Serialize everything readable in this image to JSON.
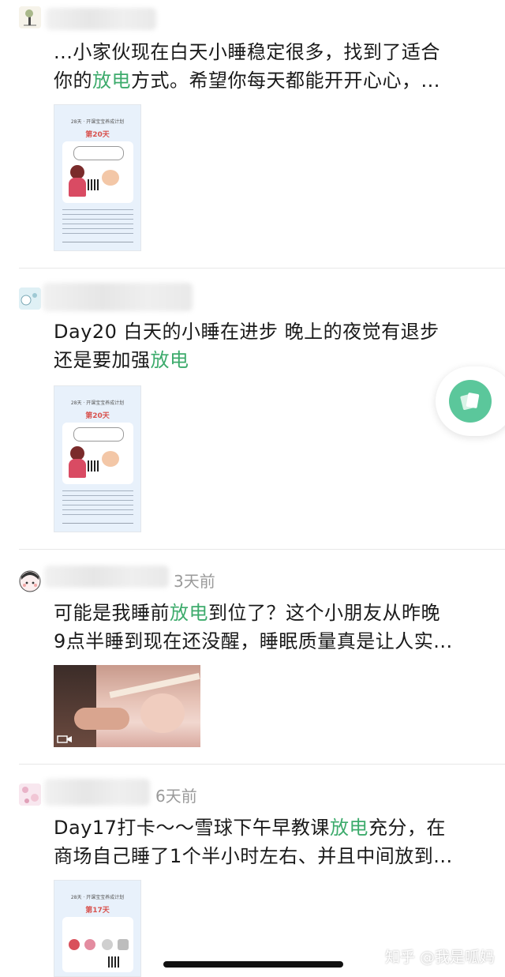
{
  "posts": [
    {
      "time": "",
      "line1_a": "...小家伙现在白天小睡稳定很多，找到了适合",
      "line1_hl": "",
      "line1_b": "",
      "line2_a": "你的",
      "line2_hl": "放电",
      "line2_b": "方式。希望你每天都能开开心心，..."
    },
    {
      "time": "",
      "line1_a": "Day20 白天的小睡在进步 晚上的夜觉有退步",
      "line1_hl": "",
      "line1_b": "",
      "line2_a": "还是要加强",
      "line2_hl": "放电",
      "line2_b": ""
    },
    {
      "time": "3天前",
      "line1_a": "可能是我睡前",
      "line1_hl": "放电",
      "line1_b": "到位了？这个小朋友从昨晚",
      "line2_a": "9点半睡到现在还没醒，睡眠质量真是让人实...",
      "line2_hl": "",
      "line2_b": ""
    },
    {
      "time": "6天前",
      "line1_a": "Day17打卡～～雪球下午早教课",
      "line1_hl": "放电",
      "line1_b": "充分，在",
      "line2_a": "商场自己睡了1个半小时左右、并且中间放到...",
      "line2_hl": "",
      "line2_b": ""
    }
  ],
  "thumbs": [
    {
      "title": "28天 · 开课宝宝养成计划",
      "day": "第20天"
    },
    {
      "title": "28天 · 开课宝宝养成计划",
      "day": "第20天"
    },
    {
      "title": "28天 · 开课宝宝养成计划",
      "day": "第17天"
    }
  ],
  "watermark": "知乎 @我是呱妈",
  "colors": {
    "highlight": "#3dab6c",
    "fab": "#5bc79b"
  },
  "icons": {
    "fab": "note-card-icon"
  }
}
